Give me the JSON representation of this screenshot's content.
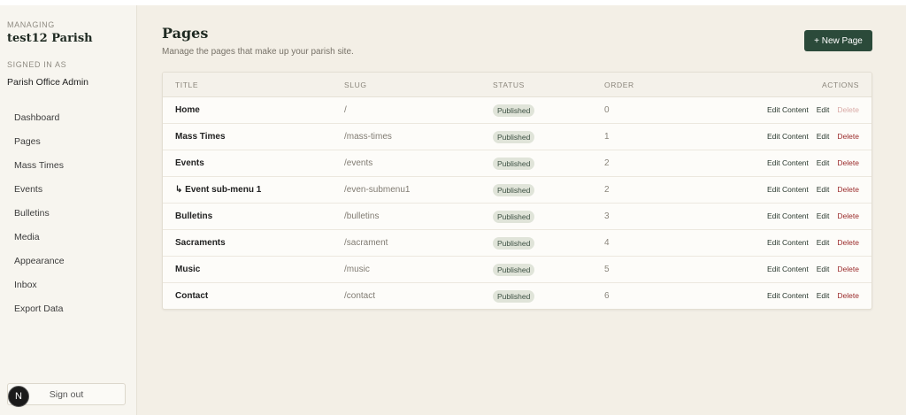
{
  "sidebar": {
    "managing_label": "MANAGING",
    "parish_name": "test12 Parish",
    "signed_in_label": "SIGNED IN AS",
    "user_name": "Parish Office Admin",
    "nav": [
      "Dashboard",
      "Pages",
      "Mass Times",
      "Events",
      "Bulletins",
      "Media",
      "Appearance",
      "Inbox",
      "Export Data"
    ],
    "sign_out": "Sign out",
    "badge": "N"
  },
  "header": {
    "title": "Pages",
    "subtitle": "Manage the pages that make up your parish site.",
    "new_button": "+ New Page"
  },
  "table": {
    "columns": [
      "TITLE",
      "SLUG",
      "STATUS",
      "ORDER",
      "ACTIONS"
    ],
    "action_labels": {
      "edit_content": "Edit Content",
      "edit": "Edit",
      "delete": "Delete"
    },
    "rows": [
      {
        "title": "Home",
        "slug": "/",
        "status": "Published",
        "order": "0",
        "delete_disabled": true
      },
      {
        "title": "Mass Times",
        "slug": "/mass-times",
        "status": "Published",
        "order": "1",
        "delete_disabled": false
      },
      {
        "title": "Events",
        "slug": "/events",
        "status": "Published",
        "order": "2",
        "delete_disabled": false
      },
      {
        "title": "↳ Event sub-menu 1",
        "slug": "/even-submenu1",
        "status": "Published",
        "order": "2",
        "delete_disabled": false
      },
      {
        "title": "Bulletins",
        "slug": "/bulletins",
        "status": "Published",
        "order": "3",
        "delete_disabled": false
      },
      {
        "title": "Sacraments",
        "slug": "/sacrament",
        "status": "Published",
        "order": "4",
        "delete_disabled": false
      },
      {
        "title": "Music",
        "slug": "/music",
        "status": "Published",
        "order": "5",
        "delete_disabled": false
      },
      {
        "title": "Contact",
        "slug": "/contact",
        "status": "Published",
        "order": "6",
        "delete_disabled": false
      }
    ]
  },
  "colors": {
    "accent": "#2b4a3a",
    "delete": "#9b2c2c",
    "background": "#f3efe6"
  }
}
